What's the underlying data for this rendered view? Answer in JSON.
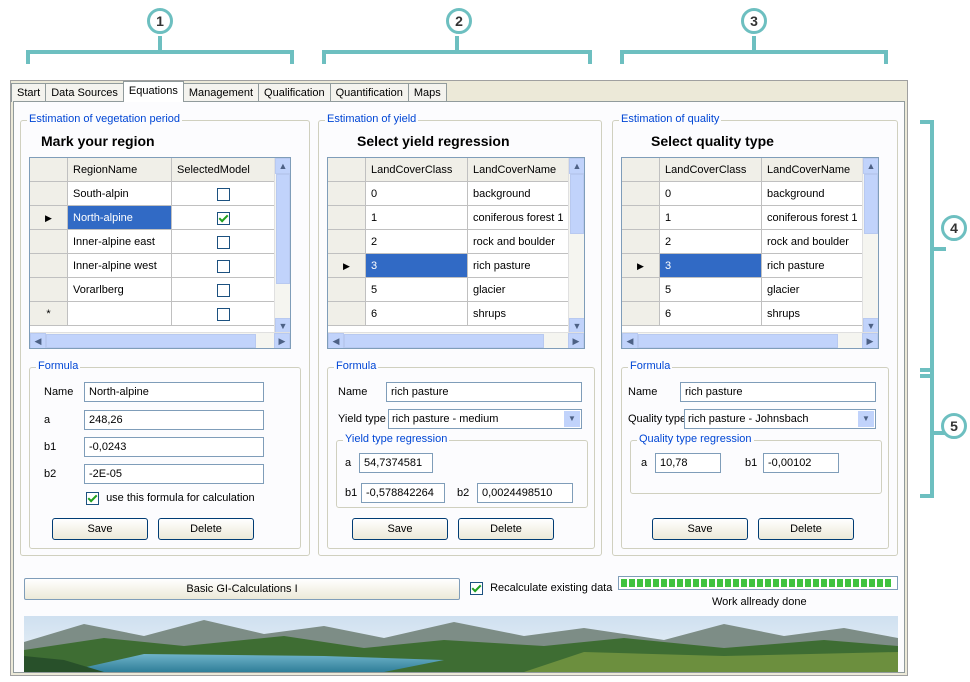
{
  "annotations": {
    "c1": "1",
    "c2": "2",
    "c3": "3",
    "c4": "4",
    "c5": "5"
  },
  "tabs": [
    "Start",
    "Data Sources",
    "Equations",
    "Management",
    "Qualification",
    "Quantification",
    "Maps"
  ],
  "active_tab": "Equations",
  "vegetation": {
    "group_title": "Estimation of vegetation period",
    "heading": "Mark your region",
    "columns": [
      "RegionName",
      "SelectedModel"
    ],
    "rows": [
      {
        "name": "South-alpin",
        "checked": false
      },
      {
        "name": "North-alpine",
        "checked": true
      },
      {
        "name": "Inner-alpine east",
        "checked": false
      },
      {
        "name": "Inner-alpine west",
        "checked": false
      },
      {
        "name": "Vorarlberg",
        "checked": false
      },
      {
        "name": "",
        "checked": false
      }
    ],
    "new_row_marker": "*",
    "formula": {
      "title": "Formula",
      "name_label": "Name",
      "name_value": "North-alpine",
      "a_label": "a",
      "a_value": "248,26",
      "b1_label": "b1",
      "b1_value": "-0,0243",
      "b2_label": "b2",
      "b2_value": "-2E-05",
      "use_label": "use this formula for calculation"
    },
    "save": "Save",
    "delete": "Delete"
  },
  "yield": {
    "group_title": "Estimation of yield",
    "heading": "Select yield regression",
    "columns": [
      "LandCoverClass",
      "LandCoverName"
    ],
    "rows": [
      {
        "cls": "0",
        "name": "background"
      },
      {
        "cls": "1",
        "name": "coniferous forest 1"
      },
      {
        "cls": "2",
        "name": "rock and boulder"
      },
      {
        "cls": "3",
        "name": "rich pasture"
      },
      {
        "cls": "5",
        "name": "glacier"
      },
      {
        "cls": "6",
        "name": "shrups"
      }
    ],
    "formula": {
      "title": "Formula",
      "name_label": "Name",
      "name_value": "rich pasture",
      "type_label": "Yield type",
      "type_value": "rich pasture - medium",
      "reg_title": "Yield type regression",
      "a_label": "a",
      "a_value": "54,7374581",
      "b1_label": "b1",
      "b1_value": "-0,578842264",
      "b2_label": "b2",
      "b2_value": "0,0024498510"
    },
    "save": "Save",
    "delete": "Delete"
  },
  "quality": {
    "group_title": "Estimation of quality",
    "heading": "Select quality type",
    "columns": [
      "LandCoverClass",
      "LandCoverName"
    ],
    "rows": [
      {
        "cls": "0",
        "name": "background"
      },
      {
        "cls": "1",
        "name": "coniferous forest 1"
      },
      {
        "cls": "2",
        "name": "rock and boulder"
      },
      {
        "cls": "3",
        "name": "rich pasture"
      },
      {
        "cls": "5",
        "name": "glacier"
      },
      {
        "cls": "6",
        "name": "shrups"
      }
    ],
    "formula": {
      "title": "Formula",
      "name_label": "Name",
      "name_value": "rich pasture",
      "type_label": "Quality type",
      "type_value": "rich pasture - Johnsbach",
      "reg_title": "Quality type regression",
      "a_label": "a",
      "a_value": "10,78",
      "b1_label": "b1",
      "b1_value": "-0,00102"
    },
    "save": "Save",
    "delete": "Delete"
  },
  "footer": {
    "calc_button": "Basic GI-Calculations I",
    "recalc_label": "Recalculate existing data",
    "progress_fraction": 1.0,
    "progress_label": "Work allready done"
  },
  "colors": {
    "accent": "#6dbfc0",
    "selection": "#316ac5",
    "group_title": "#0046d5"
  },
  "icons": {
    "row_pointer": "triangle-right-icon",
    "check": "checkmark-icon"
  }
}
